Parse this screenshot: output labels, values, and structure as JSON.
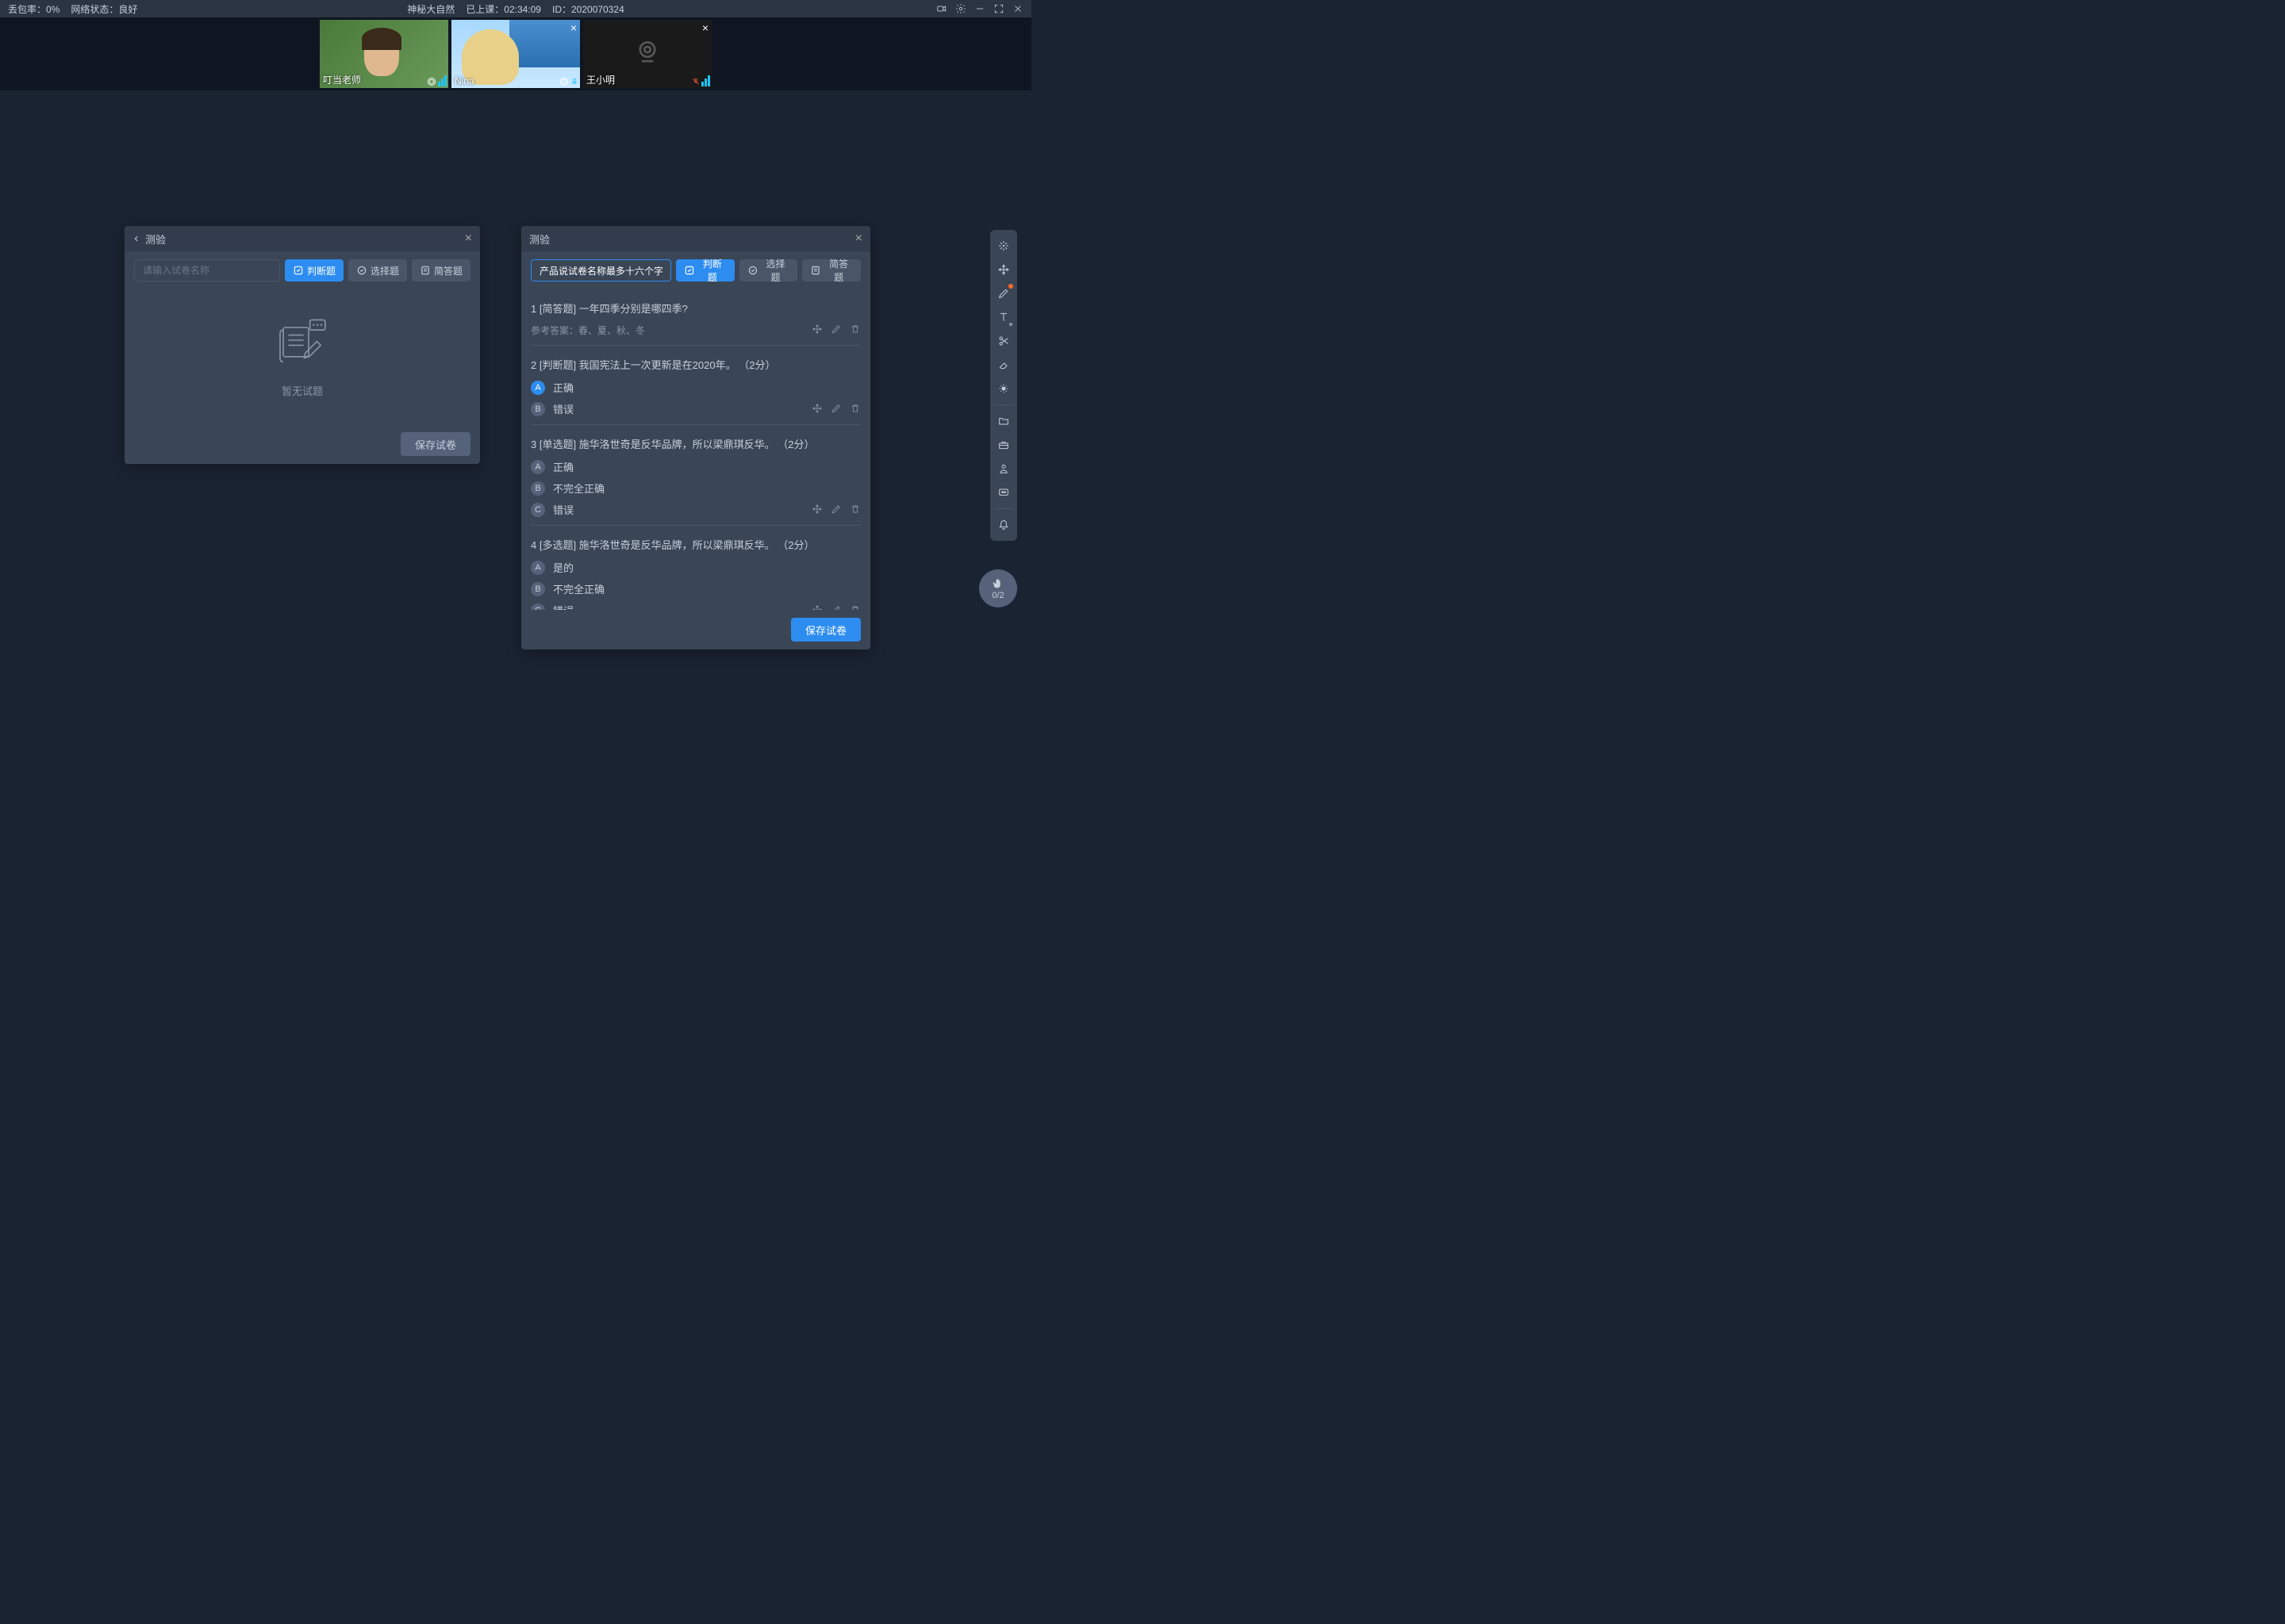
{
  "status": {
    "loss_rate_label": "丢包率：",
    "loss_rate_value": "0%",
    "network_label": "网络状态：",
    "network_value": "良好",
    "title": "神秘大自然",
    "elapsed_label": "已上课：",
    "elapsed_value": "02:34:09",
    "id_label": "ID：",
    "id_value": "2020070324"
  },
  "videos": [
    {
      "name": "叮当老师",
      "closable": false
    },
    {
      "name": "Nina",
      "closable": true
    },
    {
      "name": "王小明",
      "closable": true
    }
  ],
  "panel_left": {
    "title": "测验",
    "name_placeholder": "请输入试卷名称",
    "btn_judge": "判断题",
    "btn_choice": "选择题",
    "btn_short": "简答题",
    "empty_text": "暂无试题",
    "save_btn": "保存试卷"
  },
  "panel_right": {
    "title": "测验",
    "name_value": "产品说试卷名称最多十六个字",
    "btn_judge": "判断题",
    "btn_choice": "选择题",
    "btn_short": "简答题",
    "save_btn": "保存试卷",
    "answer_ref_prefix": "参考答案：",
    "questions": [
      {
        "idx": "1",
        "type": "[简答题]",
        "text": "一年四季分别是哪四季?",
        "answer_ref": "春、夏、秋、冬"
      },
      {
        "idx": "2",
        "type": "[判断题]",
        "text": "我国宪法上一次更新是在2020年。",
        "score": "（2分）",
        "options": [
          {
            "label": "A",
            "text": "正确",
            "correct": true
          },
          {
            "label": "B",
            "text": "错误",
            "correct": false
          }
        ]
      },
      {
        "idx": "3",
        "type": "[单选题]",
        "text": "施华洛世奇是反华品牌，所以梁鼎琪反华。",
        "score": "（2分）",
        "options": [
          {
            "label": "A",
            "text": "正确",
            "correct": false
          },
          {
            "label": "B",
            "text": "不完全正确",
            "correct": false
          },
          {
            "label": "C",
            "text": "错误",
            "correct": false
          }
        ]
      },
      {
        "idx": "4",
        "type": "[多选题]",
        "text": "施华洛世奇是反华品牌，所以梁鼎琪反华。",
        "score": "（2分）",
        "options": [
          {
            "label": "A",
            "text": "是的",
            "correct": false
          },
          {
            "label": "B",
            "text": "不完全正确",
            "correct": false
          },
          {
            "label": "C",
            "text": "错误",
            "correct": false
          }
        ]
      }
    ]
  },
  "hand_count": "0/2"
}
